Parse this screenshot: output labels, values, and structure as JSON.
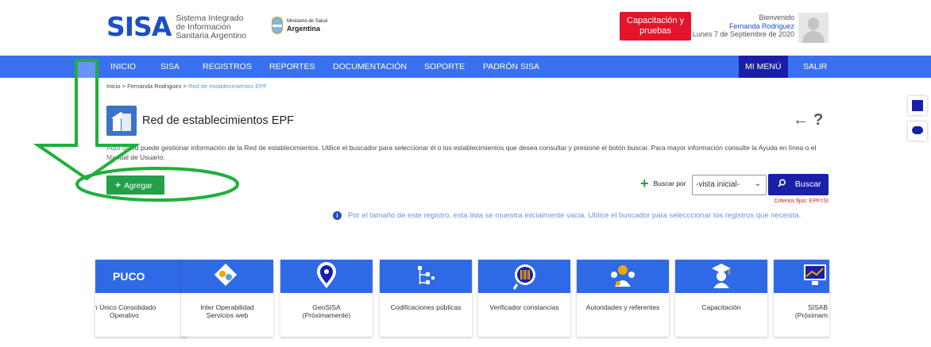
{
  "header": {
    "logo_text": "SISA",
    "logo_subtitle_line1": "Sistema Integrado",
    "logo_subtitle_line2": "de Información",
    "logo_subtitle_line3": "Sanitaria Argentino",
    "ministerio_small": "Ministerio de Salud",
    "ministerio_big": "Argentina",
    "capacitacion_line1": "Capacitación y",
    "capacitacion_line2": "pruebas",
    "welcome": "Bienvenido",
    "user_name": "Fernanda Rodriguez",
    "date": "Lunes 7 de Septiembre de 2020"
  },
  "nav": {
    "items": [
      "INICIO",
      "SISA",
      "REGISTROS",
      "REPORTES",
      "DOCUMENTACIÓN",
      "SOPORTE",
      "PADRÓN SISA"
    ],
    "mi_menu": "MI MENÚ",
    "salir": "SALIR"
  },
  "breadcrumb": {
    "home": "Inicio",
    "sep": ">",
    "user": "Fernanda Rodriguez",
    "current": "Red de establecimientos EPF"
  },
  "page": {
    "title": "Red de establecimientos EPF",
    "description": "Aquí usted puede gestionar información de la Red de establecimientos. Utilice el buscador para seleccionar él o los establecimientos que desea consultar y presione el botón buscar. Para mayor información consulte la Ayuda en línea o el Manual de Usuario.",
    "agregar_label": "Agregar",
    "buscar_por_label": "Buscar por",
    "select_value": "-vista inicial-",
    "buscar_label": "Buscar",
    "criterios": "Criterios fijos: EPF=SI",
    "info_text": "Por el tamaño de este registro, esta lista se muestra inicialmente vacia. Utilice el buscador para selecccionar los registros que necesita."
  },
  "tiles": [
    {
      "head": "PUCO",
      "label_line1": "n Único Consolidado",
      "label_line2": "Operativo"
    },
    {
      "head": "",
      "label_line1": "Inter Operabilidad",
      "label_line2": "Servicios web"
    },
    {
      "head": "",
      "label_line1": "GeoSISA",
      "label_line2": "(Próximamente)"
    },
    {
      "head": "",
      "label_line1": "Codificaciones públicas",
      "label_line2": ""
    },
    {
      "head": "",
      "label_line1": "Verificador constancias",
      "label_line2": ""
    },
    {
      "head": "",
      "label_line1": "Autoridades y referentes",
      "label_line2": ""
    },
    {
      "head": "",
      "label_line1": "Capacitación",
      "label_line2": ""
    },
    {
      "head": "",
      "label_line1": "SISAB",
      "label_line2": "(Próximam"
    }
  ],
  "colors": {
    "nav_blue": "#3970f0",
    "dark_blue": "#1a1fa8",
    "green": "#22a04a",
    "red": "#e4142c",
    "annotation_green": "#1fb03a"
  },
  "icons": [
    "shortcut-icon",
    "chat-icon",
    "back-arrow-icon",
    "help-icon",
    "info-icon",
    "search-icon",
    "plus-icon"
  ]
}
